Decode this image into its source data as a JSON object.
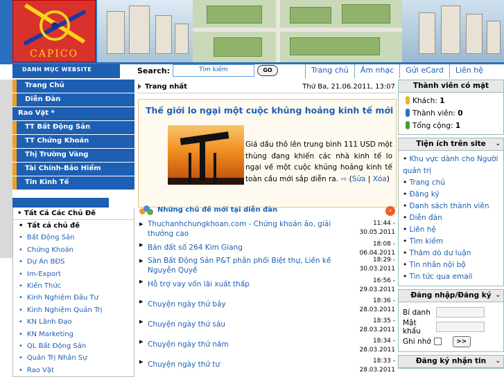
{
  "banner": {
    "logo_text": "CAPICO"
  },
  "navbar": {
    "directory_label": "DANH MỤC WEBSITE",
    "search_label": "Search:",
    "search_placeholder": "Tìm kiếm",
    "go_label": "GO",
    "links": [
      "Trang chủ",
      "Âm nhạc",
      "Gửi eCard",
      "Liên hệ"
    ]
  },
  "left_menu": [
    "Trang Chủ",
    "Diễn Đàn",
    "Rao Vặt *",
    "TT Bất Động Sản",
    "TT Chứng Khoán",
    "Thị Trường Vàng",
    "Tài Chính-Bảo Hiểm",
    "Tin Kinh Tế"
  ],
  "topics": {
    "title": "Tất Cả Các Chủ Đề",
    "items": [
      "Tất cả chủ đề",
      "Bất Động Sản",
      "Chứng Khoán",
      "Dự Án BĐS",
      "Im-Export",
      "Kiến Thức",
      "Kinh Nghiệm Đầu Tư",
      "Kinh Nghiệm Quản Trị",
      "KN Lãnh Đạo",
      "KN Marketing",
      "QL Bất Động Sản",
      "Quản Trị Nhân Sự",
      "Rao Vặt"
    ]
  },
  "center": {
    "section": "Trang nhất",
    "date": "Thứ Ba, 21.06.2011, 13:07",
    "headline": "Thế giới lo ngại một cuộc khủng hoảng kinh tế mới",
    "summary": "Giá dầu thô lên trung bình 111 USD một thùng đang khiến các nhà kinh tế lo ngại về một cuộc khủng hoảng kinh tế toàn cầu mới sắp diễn ra.",
    "edit_label": "Sửa",
    "delete_label": "Xóa"
  },
  "forum": {
    "title": "Những chủ đề mới tại diễn đàn",
    "rows": [
      {
        "title": "Thuchanhchungkhoan.com - Chứng khoán ảo, giải thưởng cao",
        "time": "11:44 -",
        "date": "30.05.2011"
      },
      {
        "title": "Bán đất số 264 Kim Giang",
        "time": "18:08 -",
        "date": "06.04.2011"
      },
      {
        "title": "Sàn Bất Động Sản P&T phân phối Biệt thự, Liền kề Nguyễn Quyề",
        "time": "18:29 -",
        "date": "30.03.2011"
      },
      {
        "title": "Hỗ trợ vay vốn lãi xuất thấp",
        "time": "16:56 -",
        "date": "29.03.2011"
      },
      {
        "title": "Chuyện ngày thứ bảy",
        "time": "18:36 -",
        "date": "28.03.2011"
      },
      {
        "title": "Chuyện ngày thứ sáu",
        "time": "18:35 -",
        "date": "28.03.2011"
      },
      {
        "title": "Chuyện ngày thứ năm",
        "time": "18:34 -",
        "date": "28.03.2011"
      },
      {
        "title": "Chuyện ngày thứ tư",
        "time": "18:33 -",
        "date": "28.03.2011"
      }
    ]
  },
  "members": {
    "title": "Thành viên có mặt",
    "guests_label": "Khách:",
    "guests": "1",
    "members_label": "Thành viên:",
    "members": "0",
    "total_label": "Tổng cộng:",
    "total": "1"
  },
  "utilities": {
    "title": "Tiện ích trên site",
    "items": [
      "Khu vực dành cho Người quản trị",
      "Trang chủ",
      "Đăng ký",
      "Danh sách thành viên",
      "Diễn đàn",
      "Liên hệ",
      "Tìm kiếm",
      "Thăm dò dư luận",
      "Tin nhắn nội bộ",
      "Tin tức qua email"
    ]
  },
  "login": {
    "title": "Đăng nhập/Đăng ký",
    "nick_label": "Bí danh",
    "password_label": "Mật khẩu",
    "remember_label": "Ghi nhớ",
    "submit_label": ">>"
  },
  "newsletter": {
    "title": "Đăng ký nhận tin"
  }
}
